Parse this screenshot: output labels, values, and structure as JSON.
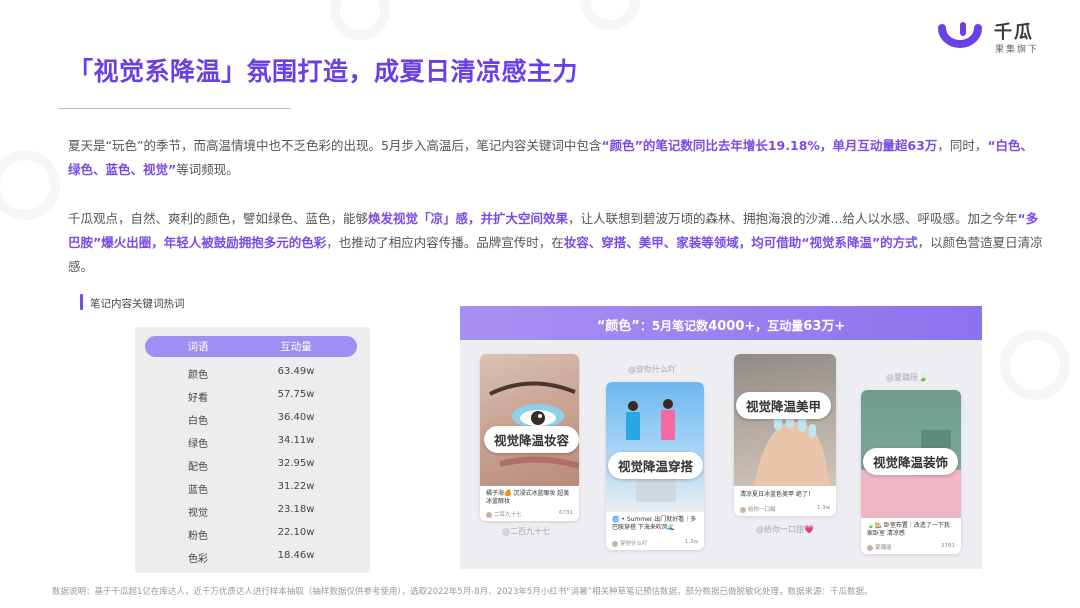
{
  "brand": {
    "name": "千瓜",
    "sub": "果集旗下",
    "color": "#6a3fe6"
  },
  "title": "「视觉系降温」氛围打造，成夏日清凉感主力",
  "para1": {
    "t1": "夏天是“玩色”的季节，而高温情境中也不乏色彩的出现。5月步入高温后，笔记内容关键词中包含",
    "h1": "“颜色”的笔记数同比去年增长19.18%，单月互动量超63万",
    "t2": "，同时，",
    "h2": "“白色、绿色、蓝色、视觉”",
    "t3": "等词频现。"
  },
  "para2": {
    "t1": "千瓜观点，自然、爽利的颜色，譬如绿色、蓝色，能够",
    "h1": "焕发视觉「凉」感，并扩大空间效果",
    "t2": "，让人联想到碧波万顷的森林、拥抱海浪的沙滩...给人以水感、呼吸感。加之今年",
    "h2": "“多巴胺”爆火出圈，年轻人被鼓励拥抱多元的色彩",
    "t3": "，也推动了相应内容传播。品牌宣传时，在",
    "h3": "妆容、穿搭、美甲、家装等领域，均可借助“视觉系降温”的方式",
    "t4": "，以颜色营造夏日清凉感。"
  },
  "keyword_table": {
    "title": "笔记内容关键词热词",
    "headers": [
      "词语",
      "互动量"
    ],
    "rows": [
      {
        "word": "颜色",
        "value": "63.49w"
      },
      {
        "word": "好看",
        "value": "57.75w"
      },
      {
        "word": "白色",
        "value": "36.40w"
      },
      {
        "word": "绿色",
        "value": "34.11w"
      },
      {
        "word": "配色",
        "value": "32.95w"
      },
      {
        "word": "蓝色",
        "value": "31.22w"
      },
      {
        "word": "视觉",
        "value": "23.18w"
      },
      {
        "word": "粉色",
        "value": "22.10w"
      },
      {
        "word": "色彩",
        "value": "18.46w"
      }
    ]
  },
  "panel": {
    "head_a": "“颜色”",
    "head_b": "：5月笔记数",
    "head_c": "4000+",
    "head_d": "，互动量",
    "head_e": "63万+",
    "cards": [
      {
        "tag": "视觉降温妆容",
        "caption": "橘子海🍊 沉浸式冰蓝眼妆 超美 冰蓝眼妆",
        "author": "二百九十七",
        "likes": "6731",
        "handle": "@二百九十七"
      },
      {
        "tag": "视觉降温穿搭",
        "caption": "🌀 • Summer 出门就好看｜多巴胺穿搭 下海来吹风🌊",
        "author": "穿你什么吖",
        "likes": "1.3w",
        "handle": "@穿你什么吖"
      },
      {
        "tag": "视觉降温美甲",
        "caption": "清凉夏日冰蓝色美甲 绝了！",
        "author": "给你一口甜",
        "likes": "1.3w",
        "handle": "@给你一口甜💗"
      },
      {
        "tag": "视觉降温装饰",
        "caption": "🍃🏡 卧室布置｜改造了一下我家卧室 清凉感",
        "author": "夏璐瑶",
        "likes": "2791",
        "handle": "@夏璐瑶🍃"
      }
    ]
  },
  "footer": "数据说明：基于千瓜超1亿在库达人，近千万优质达人进行样本抽取（抽样数据仅供参考使用），选取2022年5月-8月、2023年5月小红书“消暑”相关种草笔记预估数据，部分数据已做脱敏化处理，数据来源：千瓜数据。"
}
